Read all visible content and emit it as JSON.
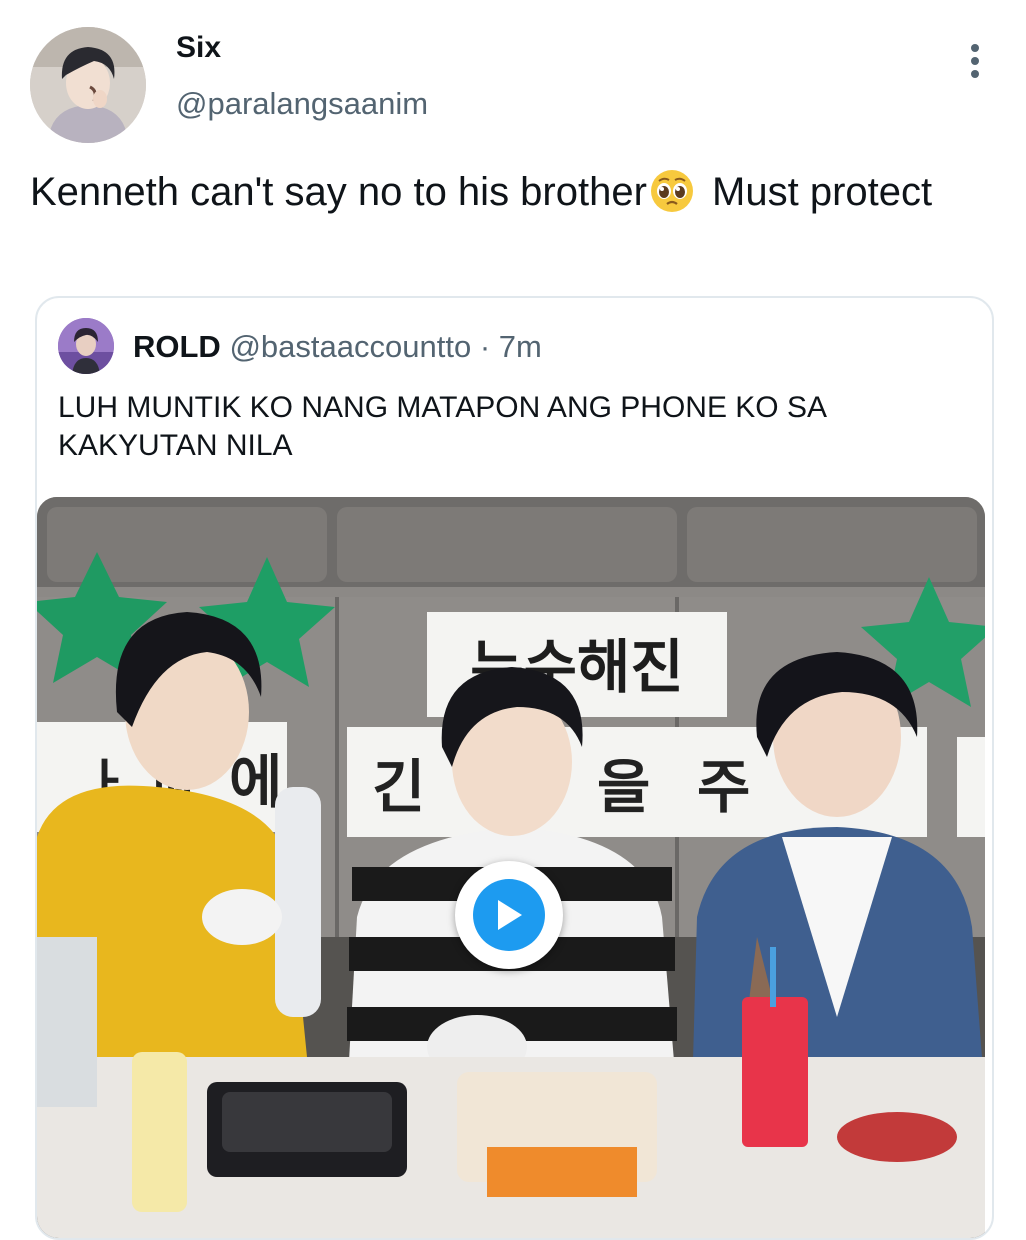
{
  "tweet": {
    "author": {
      "name": "Six",
      "handle": "@paralangsaanim"
    },
    "text_before_emoji": "Kenneth can't say no to his brother",
    "emoji": "pleading-face-emoji",
    "text_after_emoji": " Must protect"
  },
  "quoted_tweet": {
    "author": {
      "name": "ROLD",
      "handle": "@bastaaccountto"
    },
    "separator": "·",
    "time": "7m",
    "text": "LUH MUNTIK KO NANG MATAPON ANG PHONE KO SA KAKYUTAN NILA",
    "media": {
      "type": "video",
      "sign_text_top": "누수해진",
      "sign_text_row": [
        "ㅏ 피",
        "에",
        "긴",
        "을",
        "주"
      ]
    }
  },
  "icons": {
    "more": "more-vertical-icon",
    "play": "play-icon"
  },
  "colors": {
    "accent": "#1d9bf0",
    "text_primary": "#0f1419",
    "text_secondary": "#536471",
    "card_border": "#e1e8ed"
  }
}
